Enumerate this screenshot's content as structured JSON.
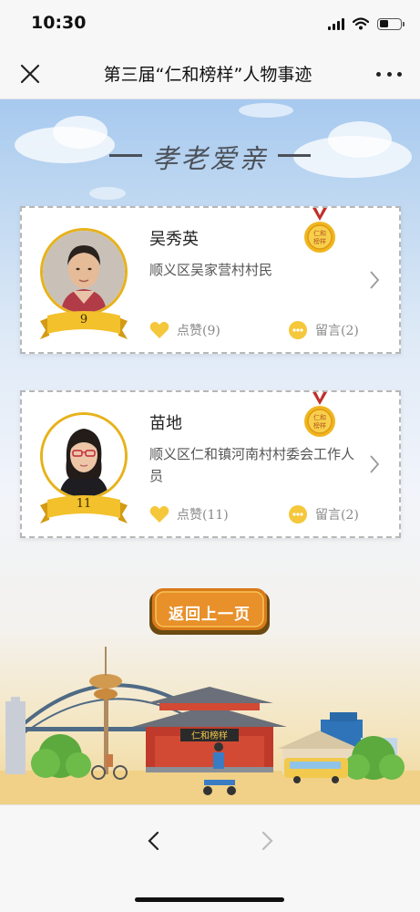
{
  "status_bar": {
    "time": "10:30",
    "icons": [
      "signal-icon",
      "wifi-icon",
      "battery-icon"
    ]
  },
  "nav": {
    "title": "第三届“仁和榜样”人物事迹",
    "close_icon": "close-icon",
    "more_icon": "more-icon"
  },
  "section": {
    "title": "孝老爱亲"
  },
  "people": [
    {
      "name": "吴秀英",
      "description": "顺义区吴家营村村民",
      "number": "9",
      "likes_label": "点赞(9)",
      "comments_label": "留言(2)",
      "medal_text": "仁和榜样"
    },
    {
      "name": "苗地",
      "description": "顺义区仁和镇河南村村委会工作人员",
      "number": "11",
      "likes_label": "点赞(11)",
      "comments_label": "留言(2)",
      "medal_text": "仁和榜样"
    }
  ],
  "back_button": {
    "label": "返回上一页"
  },
  "scene": {
    "sign_text": "仁和榜样"
  },
  "colors": {
    "gold": "#e7b21b",
    "accent_orange": "#e3861b",
    "text_dark": "#222222",
    "text_muted": "#888888"
  }
}
